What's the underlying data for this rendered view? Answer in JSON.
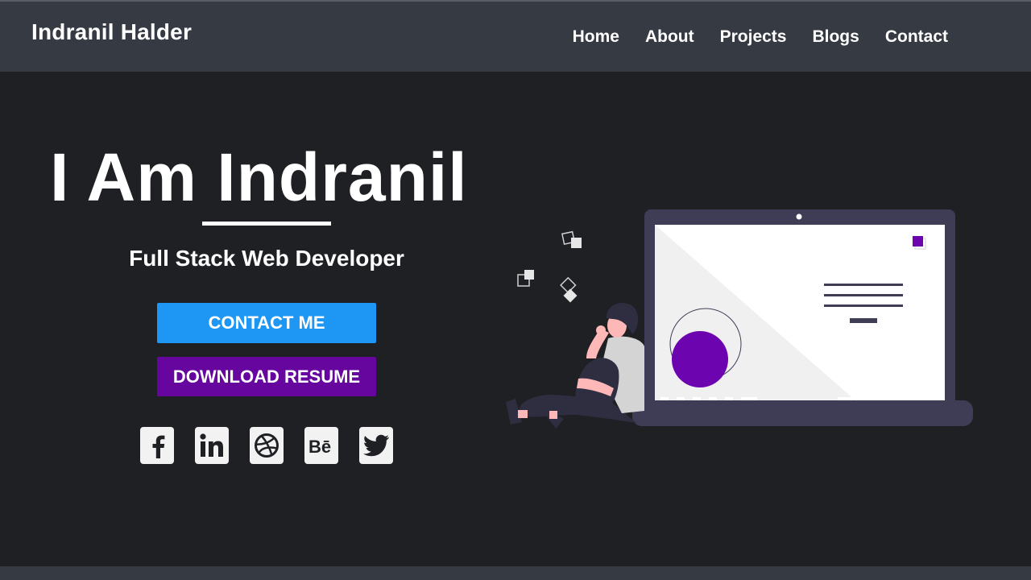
{
  "header": {
    "brand": "Indranil Halder",
    "nav": [
      "Home",
      "About",
      "Projects",
      "Blogs",
      "Contact"
    ]
  },
  "hero": {
    "title": "I Am Indranil",
    "subtitle": "Full Stack Web Developer",
    "contact_button": "CONTACT ME",
    "resume_button": "DOWNLOAD RESUME"
  },
  "social_icons": [
    "facebook-icon",
    "linkedin-icon",
    "dribbble-icon",
    "behance-icon",
    "twitter-icon"
  ],
  "behance_glyph": "Bē",
  "colors": {
    "background": "#1e2024",
    "navbar": "#363a43",
    "contact_button": "#1e96f3",
    "resume_button": "#66069e",
    "accent_purple": "#6c04b0",
    "laptop_frame": "#3f3d56"
  }
}
